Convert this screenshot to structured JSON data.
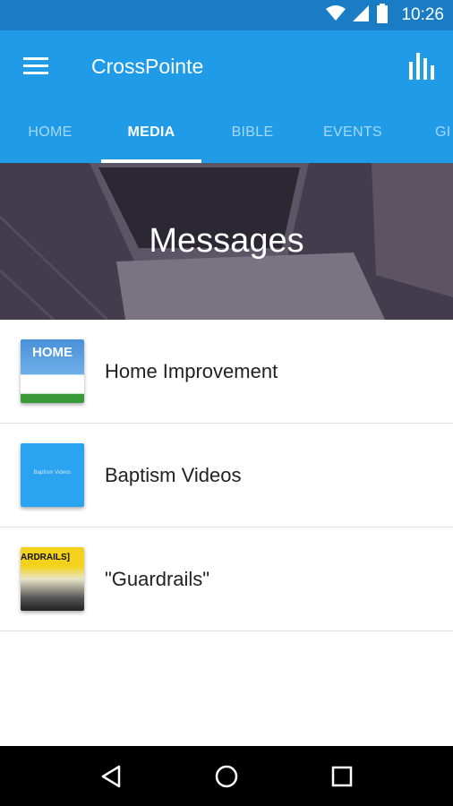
{
  "status_bar": {
    "time": "10:26",
    "icons": [
      "wifi-icon",
      "signal-icon",
      "battery-icon"
    ]
  },
  "app_bar": {
    "title": "CrossPointe",
    "icons": [
      "menu-icon",
      "bar-chart-icon"
    ]
  },
  "tabs": [
    {
      "label": "HOME",
      "active": false
    },
    {
      "label": "MEDIA",
      "active": true
    },
    {
      "label": "BIBLE",
      "active": false
    },
    {
      "label": "EVENTS",
      "active": false
    },
    {
      "label": "GI",
      "active": false
    }
  ],
  "banner": {
    "title": "Messages"
  },
  "list": [
    {
      "label": "Home Improvement",
      "thumb_text": "HOME",
      "thumb_color": "#3b7fc4"
    },
    {
      "label": "Baptism Videos",
      "thumb_text": "Baptism Videos",
      "thumb_color": "#2aa3f0"
    },
    {
      "label": "\"Guardrails\"",
      "thumb_text": "ARDRAILS]",
      "thumb_color": "#f3d21c"
    }
  ],
  "nav_bar": {
    "icons": [
      "back-icon",
      "home-icon",
      "recents-icon"
    ]
  },
  "colors": {
    "primary": "#209be8",
    "status_bar": "#1a7cc4",
    "banner": "#4c4555"
  }
}
